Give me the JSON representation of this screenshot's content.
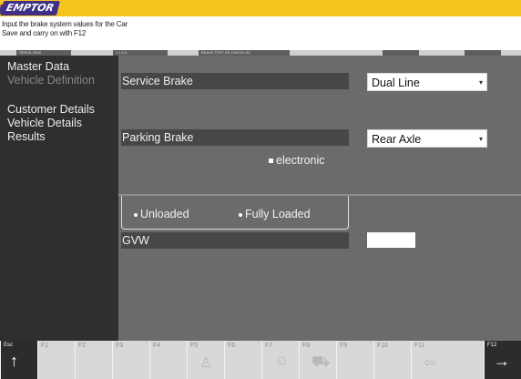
{
  "header": {
    "logo_text": "EMPTOR",
    "instructions": [
      "Input the brake system values for the Car",
      "Save and carry on with F12"
    ],
    "status_segments": [
      "SERIAL 0000",
      "1.1.0.0",
      "BRAKE TEST DE-CHECK-OK",
      "",
      ""
    ]
  },
  "sidebar": {
    "items": [
      {
        "label": "Master Data",
        "selected": false
      },
      {
        "label": "Vehicle Definition",
        "selected": true
      },
      {
        "label": "Customer Details",
        "selected": false
      },
      {
        "label": "Vehicle Details",
        "selected": false
      },
      {
        "label": "Results",
        "selected": false
      }
    ]
  },
  "form": {
    "service_brake": {
      "label": "Service Brake",
      "value": "Dual Line"
    },
    "parking_brake": {
      "label": "Parking Brake",
      "value": "Rear Axle"
    },
    "electronic": {
      "label": "electronic",
      "checked": false
    },
    "load": {
      "options": [
        "Unloaded",
        "Fully Loaded"
      ],
      "selected": "Fully Loaded"
    },
    "gvw": {
      "label": "GVW",
      "value": ""
    }
  },
  "footer": {
    "keys": [
      {
        "label": "Esc",
        "icon": "arrow-up-icon",
        "glyph": "↑"
      },
      {
        "label": "F1",
        "icon": "",
        "glyph": ""
      },
      {
        "label": "F2",
        "icon": "",
        "glyph": ""
      },
      {
        "label": "F3",
        "icon": "",
        "glyph": ""
      },
      {
        "label": "F4",
        "icon": "",
        "glyph": ""
      },
      {
        "label": "F5",
        "icon": "cup-icon",
        "glyph": "♙"
      },
      {
        "label": "F6",
        "icon": "",
        "glyph": ""
      },
      {
        "label": "F7",
        "icon": "person-icon",
        "glyph": "☺"
      },
      {
        "label": "F8",
        "icon": "car-icon",
        "glyph": "⛟"
      },
      {
        "label": "F9",
        "icon": "",
        "glyph": ""
      },
      {
        "label": "F10",
        "icon": "",
        "glyph": ""
      },
      {
        "label": "F11",
        "icon": "arrow-left-icon",
        "glyph": "⇦"
      },
      {
        "label": "F12",
        "icon": "arrow-right-icon",
        "glyph": "→"
      }
    ]
  },
  "colors": {
    "header": "#f6c21e",
    "sidebar": "#2f2f2f",
    "main": "#6b6b6b",
    "label_bg": "#474747"
  }
}
